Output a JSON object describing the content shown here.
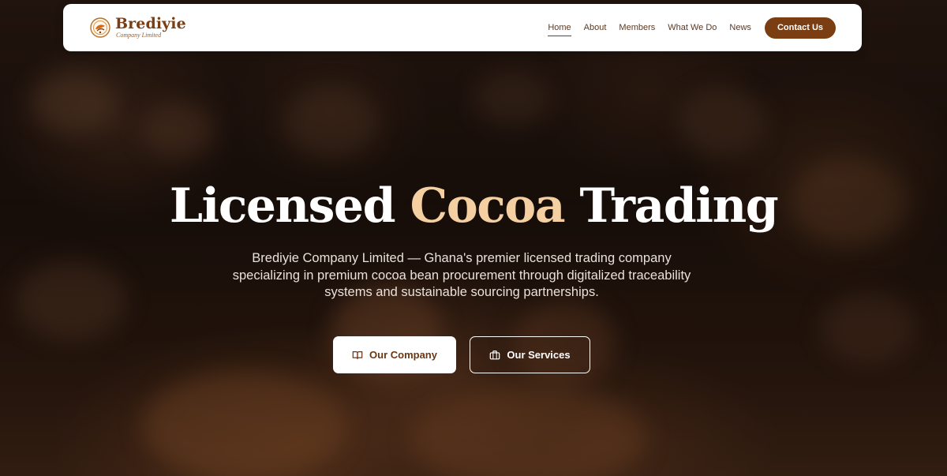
{
  "brand": {
    "name": "Brediyie",
    "tagline": "Company Limited",
    "logo_icon": "cocoa-leaf-emblem-icon"
  },
  "nav": {
    "items": [
      {
        "label": "Home",
        "active": true
      },
      {
        "label": "About",
        "active": false
      },
      {
        "label": "Members",
        "active": false
      },
      {
        "label": "What We Do",
        "active": false
      },
      {
        "label": "News",
        "active": false
      }
    ],
    "cta": "Contact Us"
  },
  "hero": {
    "headline_part1": "Licensed",
    "headline_accent": "Cocoa",
    "headline_part2": "Trading",
    "subtitle": "Brediyie Company Limited — Ghana's premier licensed trading company specializing in premium cocoa bean procurement through digitalized traceability systems and sustainable sourcing partnerships.",
    "primary_button": {
      "label": "Our Company",
      "icon": "book-open-icon"
    },
    "secondary_button": {
      "label": "Our Services",
      "icon": "briefcase-icon"
    }
  },
  "colors": {
    "brand_brown": "#7a3e12",
    "accent_cream": "#f3cfa1",
    "white": "#ffffff"
  }
}
